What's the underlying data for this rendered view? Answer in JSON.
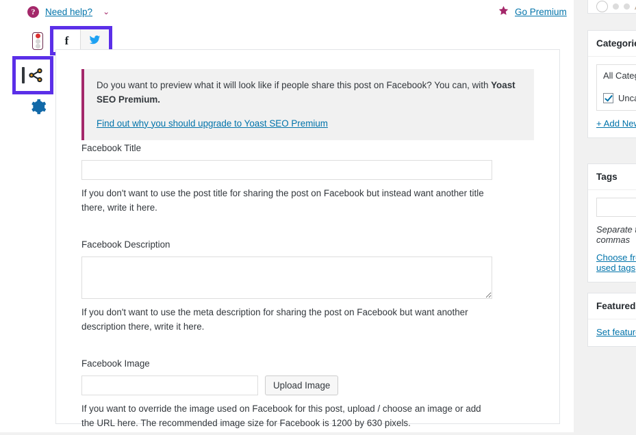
{
  "header": {
    "help_icon": "question-mark-circle-icon",
    "help_label": "Need help?",
    "help_chevron": "⌄",
    "premium_icon": "star-icon",
    "premium_label": "Go Premium",
    "link_color": "#0073aa",
    "brand_magenta": "#a4286a"
  },
  "rail": {
    "items": [
      {
        "name": "seo-score-traffic-light",
        "label": "SEO analysis"
      },
      {
        "name": "social-share-icon",
        "label": "Social"
      },
      {
        "name": "gear-icon",
        "label": "Advanced settings"
      }
    ],
    "highlight_color": "#5b2fe8"
  },
  "social_tabs": [
    {
      "id": "facebook",
      "icon": "facebook-icon",
      "glyph": "f",
      "label": "Facebook",
      "active": true
    },
    {
      "id": "twitter",
      "icon": "twitter-bird-icon",
      "label": "Twitter",
      "active": false
    }
  ],
  "notice": {
    "text_before_bold": "Do you want to preview what it will look like if people share this post on Facebook? You can, with ",
    "bold_text": "Yoast SEO Premium.",
    "link_text": "Find out why you should upgrade to Yoast SEO Premium",
    "accent_color": "#a4286a",
    "background": "#f1f1f1"
  },
  "form": {
    "title": {
      "label": "Facebook Title",
      "value": "",
      "placeholder": "",
      "hint": "If you don't want to use the post title for sharing the post on Facebook but instead want another title there, write it here."
    },
    "description": {
      "label": "Facebook Description",
      "value": "",
      "placeholder": "",
      "hint": "If you don't want to use the meta description for sharing the post on Facebook but want another description there, write it here."
    },
    "image": {
      "label": "Facebook Image",
      "value": "",
      "placeholder": "",
      "button_label": "Upload Image",
      "hint": "If you want to override the image used on Facebook for this post, upload / choose an image or add the URL here. The recommended image size for Facebook is 1200 by 630 pixels."
    }
  },
  "sidebar": {
    "partial_top": {
      "ghost_label": "A"
    },
    "categories": {
      "title": "Categories",
      "tab_label": "All Categories",
      "item_label": "Uncategorized",
      "item_checked": true,
      "add_new_label": "+ Add New Category"
    },
    "tags": {
      "title": "Tags",
      "value": "",
      "placeholder": "",
      "hint": "Separate tags with commas",
      "choose_label": "Choose from the most used tags"
    },
    "featured": {
      "title": "Featured image",
      "set_label": "Set featured image"
    }
  }
}
